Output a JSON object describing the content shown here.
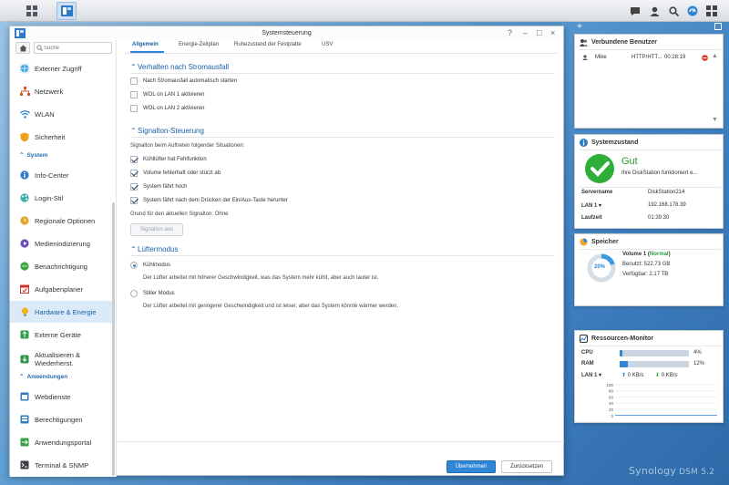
{
  "window": {
    "title": "Systemsteuerung",
    "ctrl_help": "?",
    "ctrl_min": "–",
    "ctrl_max": "□",
    "ctrl_close": "×"
  },
  "sidebar": {
    "search_placeholder": "Suche",
    "items": [
      {
        "label": "Externer Zugriff",
        "icon": "globe-icon",
        "top": 0
      },
      {
        "label": "Netzwerk",
        "icon": "network-icon"
      },
      {
        "label": "WLAN",
        "icon": "wifi-icon"
      },
      {
        "label": "Sicherheit",
        "icon": "shield-icon"
      }
    ],
    "section_system": "System",
    "system_items": [
      {
        "label": "Info-Center",
        "icon": "info-icon"
      },
      {
        "label": "Login-Stil",
        "icon": "palette-icon"
      },
      {
        "label": "Regionale Optionen",
        "icon": "globe-clock-icon"
      },
      {
        "label": "Medienindizierung",
        "icon": "media-icon"
      },
      {
        "label": "Benachrichtigung",
        "icon": "chat-icon"
      },
      {
        "label": "Aufgabenplaner",
        "icon": "calendar-icon"
      },
      {
        "label": "Hardware & Energie",
        "icon": "bulb-icon"
      },
      {
        "label": "Externe Geräte",
        "icon": "usb-icon"
      },
      {
        "label": "Aktualisieren & Wiederherst.",
        "label1": "Aktualisieren &",
        "label2": "Wiederherst.",
        "icon": "update-icon"
      }
    ],
    "section_apps": "Anwendungen",
    "app_items": [
      {
        "label": "Webdienste",
        "icon": "web-icon"
      },
      {
        "label": "Berechtigungen",
        "icon": "permissions-icon"
      },
      {
        "label": "Anwendungsportal",
        "icon": "portal-icon"
      },
      {
        "label": "Terminal & SNMP",
        "icon": "terminal-icon"
      }
    ]
  },
  "tabs": {
    "t1": "Allgemein",
    "t2": "Energie-Zeitplan",
    "t3": "Ruhezustand der Festplatte",
    "t4": "USV"
  },
  "main": {
    "sec1": "Verhalten nach Stromausfall",
    "cb1": "Nach Stromausfall automatisch starten",
    "cb2": "WOL on LAN 1 aktivieren",
    "cb3": "WOL on LAN 2 aktivieren",
    "sec2": "Signalton-Steuerung",
    "sig_intro": "Signalton beim Auftreten folgender Situationen:",
    "sig1": "Kühllüfter hat Fehlfunktion",
    "sig2": "Volume fehlerhaft oder stürzt ab",
    "sig3": "System fährt hoch",
    "sig4": "System fährt nach dem Drücken der Ein/Aus-Taste herunter",
    "sig_reason": "Grund für den aktuellen Signalton: Ohne",
    "sig_off_btn": "Signalton aus",
    "sec3": "Lüftermodus",
    "fan1": "Kühlmodus",
    "fan1_desc": "Der Lüfter arbeitet mit höherer Geschwindigkeit, was das System mehr kühlt, aber auch lauter ist.",
    "fan2": "Stiller Modus",
    "fan2_desc": "Der Lüfter arbeitet mit geringerer Geschwindigkeit und ist leiser, aber das System könnte wärmer werden.",
    "apply": "Übernehmen",
    "reset": "Zurücksetzen"
  },
  "widgets": {
    "add": "+",
    "users": {
      "title": "Verbundene Benutzer",
      "name": "Mike",
      "type": "HTTP/HTT...",
      "time": "00:28:19"
    },
    "health": {
      "title": "Systemzustand",
      "status": "Gut",
      "message": "Ihre DiskStation funktioniert e...",
      "server_label": "Servername",
      "server": "DiskStation214",
      "lan_label": "LAN 1 ▾",
      "ip": "192.168.178.39",
      "uptime_label": "Laufzeit",
      "uptime": "01:39:30"
    },
    "storage": {
      "title": "Speicher",
      "percent": "20%",
      "percent_value": 20,
      "volume": "Volume 1 (",
      "volume_status": "Normal",
      "volume_close": ")",
      "used": "Benutzt: 522.73 GB",
      "free": "Verfügbar: 2.17 TB"
    },
    "monitor": {
      "title": "Ressourcen-Monitor",
      "cpu_label": "CPU",
      "cpu": "4%",
      "cpu_value": 4,
      "ram_label": "RAM",
      "ram": "12%",
      "ram_value": 12,
      "lan_label": "LAN 1 ▾",
      "up": "0 KB/s",
      "down": "0 KB/s",
      "ticks": [
        "100",
        "80",
        "60",
        "40",
        "20",
        "0"
      ]
    }
  },
  "logo": {
    "brand": "Synology",
    "product": " DSM 5.2"
  },
  "colors": {
    "accent": "#2f86d6",
    "ok_green": "#2fae3a",
    "selected_bg": "#dbeaf8"
  }
}
